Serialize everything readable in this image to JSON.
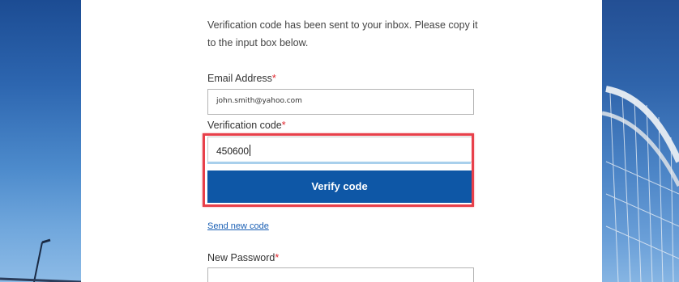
{
  "form": {
    "intro_text": "Verification code has been sent to your inbox. Please copy it to the input box below.",
    "email_label": "Email Address",
    "email_value": "john.smith@yahoo.com",
    "verification_label": "Verification code",
    "verification_value": "450600",
    "required_mark": "*",
    "verify_button_label": "Verify code",
    "send_new_code_label": "Send new code",
    "new_password_label": "New Password"
  },
  "colors": {
    "button_bg": "#0e57a6",
    "highlight_border": "#e8404a",
    "link": "#1a5fb4",
    "required": "#e0262d"
  }
}
